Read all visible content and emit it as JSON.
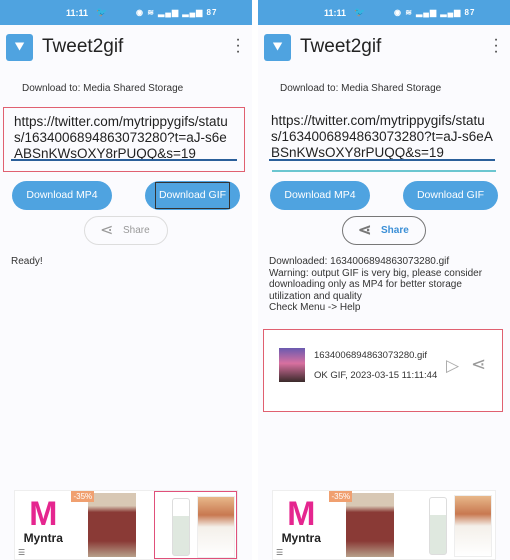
{
  "status": {
    "time": "11:11",
    "battery": "87"
  },
  "app": {
    "title": "Tweet2gif",
    "download_to": "Download to: Media Shared Storage"
  },
  "url": {
    "value": "https://twitter.com/mytrippygifs/status/1634006894863073280?t=aJ-s6eABSnKWsOXY8rPUQQ&s=19"
  },
  "buttons": {
    "mp4": "Download MP4",
    "gif": "Download GIF",
    "share": "Share"
  },
  "left": {
    "status_text": "Ready!"
  },
  "right": {
    "messages": [
      "Downloaded: 1634006894863073280.gif",
      "Warning: output GIF is very big, please consider downloading only as MP4 for better storage utilization and quality",
      "Check Menu -> Help"
    ],
    "file": {
      "name": "1634006894863073280.gif",
      "status": "OK GIF, 2023-03-15 11:11:44"
    }
  },
  "ads": {
    "brand": "Myntra",
    "discount": "-35%"
  },
  "colors": {
    "accent": "#4fa3e0",
    "highlight": "#e06070"
  }
}
